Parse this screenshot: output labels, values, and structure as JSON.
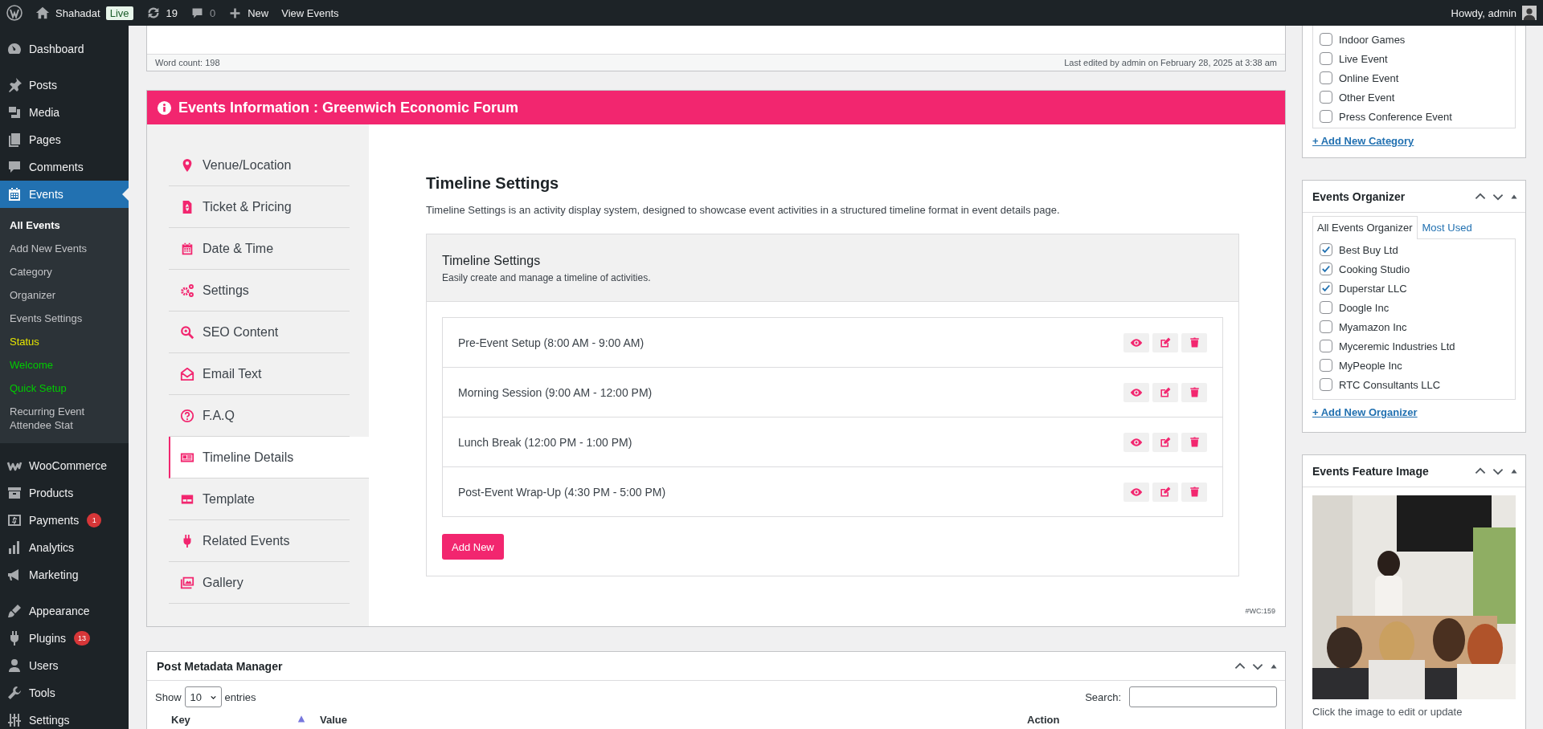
{
  "admin_bar": {
    "site": "Shahadat",
    "badge": "Live",
    "updates": "19",
    "comments": "0",
    "new": "New",
    "view": "View Events",
    "howdy": "Howdy, admin"
  },
  "menu": [
    [
      {
        "label": "Dashboard",
        "selected": false
      }
    ],
    [
      {
        "label": "Posts",
        "selected": false
      },
      {
        "label": "Media",
        "selected": false
      },
      {
        "label": "Pages",
        "selected": false
      },
      {
        "label": "Comments",
        "selected": false
      },
      {
        "label": "Events",
        "selected": true,
        "children": [
          {
            "label": "All Events",
            "selected": true,
            "color": "#ffffff"
          },
          {
            "label": "Add New Events",
            "selected": false,
            "color": "#c3c4c7"
          },
          {
            "label": "Category",
            "selected": false,
            "color": "#c3c4c7"
          },
          {
            "label": "Organizer",
            "selected": false,
            "color": "#c3c4c7"
          },
          {
            "label": "Events Settings",
            "selected": false,
            "color": "#c3c4c7"
          },
          {
            "label": "Status",
            "selected": false,
            "color": "#e6e600"
          },
          {
            "label": "Welcome",
            "selected": false,
            "color": "#00cc00"
          },
          {
            "label": "Quick Setup",
            "selected": false,
            "color": "#00cc00"
          },
          {
            "label": "Recurring Event Attendee Stat",
            "selected": false,
            "color": "#c3c4c7"
          }
        ]
      }
    ],
    [
      {
        "label": "WooCommerce",
        "selected": false
      },
      {
        "label": "Products",
        "selected": false
      },
      {
        "label": "Payments",
        "selected": false,
        "badge": "1"
      },
      {
        "label": "Analytics",
        "selected": false
      },
      {
        "label": "Marketing",
        "selected": false
      }
    ],
    [
      {
        "label": "Appearance",
        "selected": false
      },
      {
        "label": "Plugins",
        "selected": false,
        "badge": "13"
      },
      {
        "label": "Users",
        "selected": false
      },
      {
        "label": "Tools",
        "selected": false
      },
      {
        "label": "Settings",
        "selected": false
      }
    ]
  ],
  "editor": {
    "word_count": "Word count: 198",
    "last_edited": "Last edited by admin on February 28, 2025 at 3:38 am"
  },
  "events_info": {
    "title": "Events Information : Greenwich Economic Forum",
    "tabs": [
      {
        "label": "Venue/Location",
        "selected": false
      },
      {
        "label": "Ticket & Pricing",
        "selected": false
      },
      {
        "label": "Date & Time",
        "selected": false
      },
      {
        "label": "Settings",
        "selected": false
      },
      {
        "label": "SEO Content",
        "selected": false
      },
      {
        "label": "Email Text",
        "selected": false
      },
      {
        "label": "F.A.Q",
        "selected": false
      },
      {
        "label": "Timeline Details",
        "selected": true
      },
      {
        "label": "Template",
        "selected": false
      },
      {
        "label": "Related Events",
        "selected": false
      },
      {
        "label": "Gallery",
        "selected": false
      }
    ],
    "heading": "Timeline Settings",
    "description": "Timeline Settings is an activity display system, designed to showcase event activities in a structured timeline format in event details page.",
    "panel": {
      "title": "Timeline Settings",
      "subtitle": "Easily create and manage a timeline of activities."
    },
    "items": [
      "Pre-Event Setup (8:00 AM - 9:00 AM)",
      "Morning Session (9:00 AM - 12:00 PM)",
      "Lunch Break (12:00 PM - 1:00 PM)",
      "Post-Event Wrap-Up (4:30 PM - 5:00 PM)"
    ],
    "add_button": "Add New",
    "footer": "#WC:159"
  },
  "categories": {
    "items": [
      {
        "label": "Indoor Games",
        "checked": false
      },
      {
        "label": "Live Event",
        "checked": false
      },
      {
        "label": "Online Event",
        "checked": false
      },
      {
        "label": "Other Event",
        "checked": false
      },
      {
        "label": "Press Conference Event",
        "checked": false
      }
    ],
    "link": "+ Add New Category"
  },
  "organizer": {
    "title": "Events Organizer",
    "tabs": [
      {
        "label": "All Events Organizer",
        "selected": true
      },
      {
        "label": "Most Used",
        "selected": false
      }
    ],
    "items": [
      {
        "label": "Best Buy Ltd",
        "checked": true
      },
      {
        "label": "Cooking Studio",
        "checked": true
      },
      {
        "label": "Duperstar LLC",
        "checked": true
      },
      {
        "label": "Doogle Inc",
        "checked": false
      },
      {
        "label": "Myamazon Inc",
        "checked": false
      },
      {
        "label": "Myceremic Industries Ltd",
        "checked": false
      },
      {
        "label": "MyPeople Inc",
        "checked": false
      },
      {
        "label": "RTC Consultants LLC",
        "checked": false
      }
    ],
    "link": "+ Add New Organizer"
  },
  "feature_image": {
    "title": "Events Feature Image",
    "caption": "Click the image to edit or update"
  },
  "metadata": {
    "title": "Post Metadata Manager",
    "show": "Show",
    "page_size": "10",
    "entries": "entries",
    "search_label": "Search:",
    "columns": [
      "Key",
      "Value",
      "Action"
    ]
  }
}
